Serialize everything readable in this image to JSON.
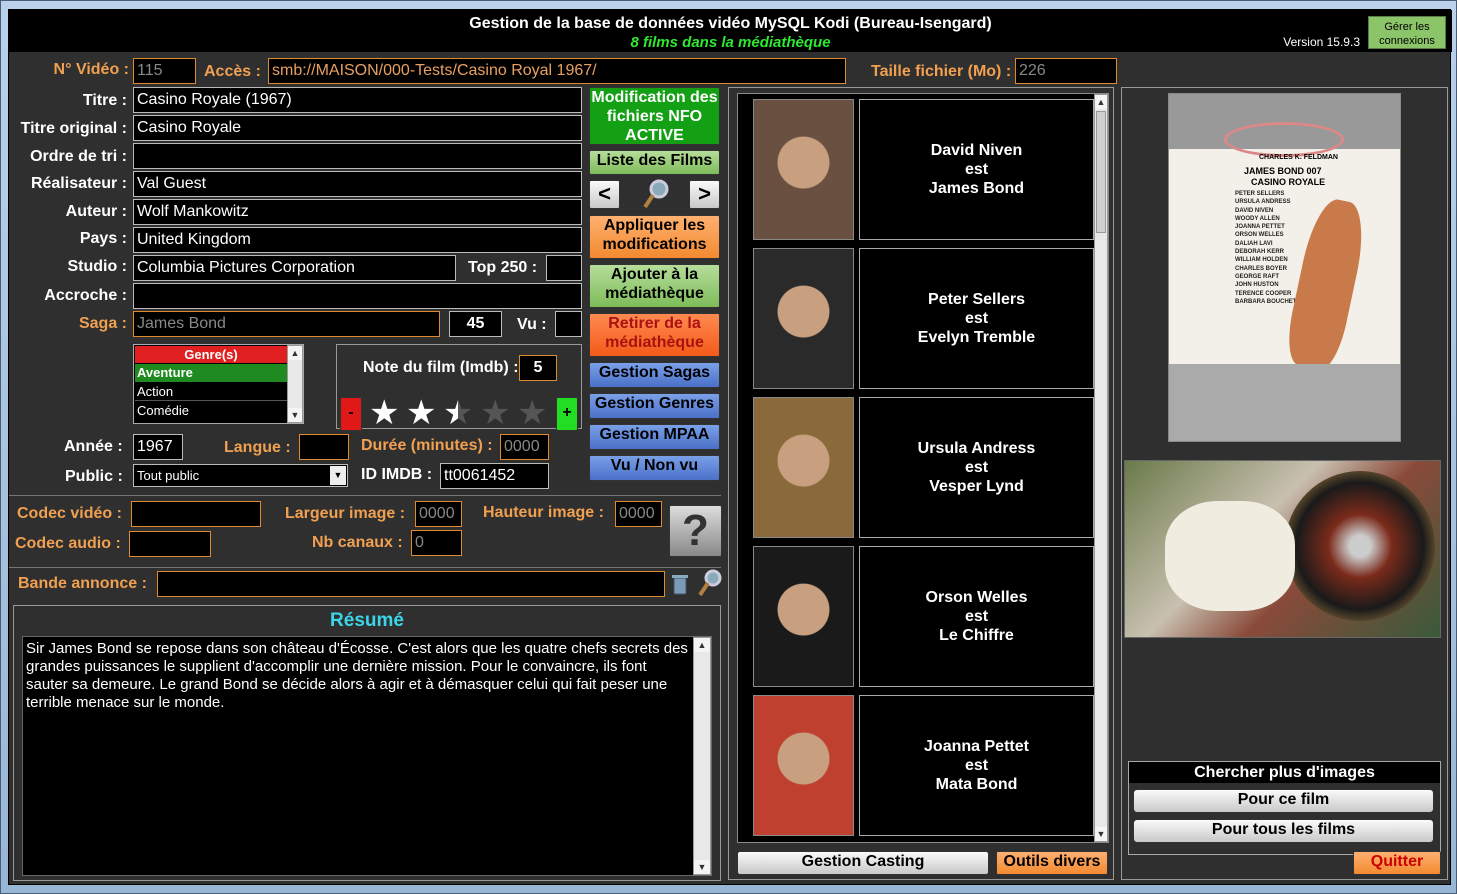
{
  "header": {
    "title": "Gestion de la base de données vidéo MySQL Kodi (Bureau-Isengard)",
    "subtitle": "8 films dans la médiathèque",
    "version": "Version 15.9.3",
    "connections_btn": "Gérer les connexions"
  },
  "fields": {
    "video_no_label": "N° Vidéo :",
    "video_no": "115",
    "access_label": "Accès :",
    "access": "smb://MAISON/000-Tests/Casino Royal 1967/",
    "size_label": "Taille fichier (Mo) :",
    "size": "226",
    "title_label": "Titre :",
    "title": "Casino Royale (1967)",
    "orig_title_label": "Titre original :",
    "orig_title": "Casino Royale",
    "sort_label": "Ordre de tri :",
    "sort": "",
    "director_label": "Réalisateur :",
    "director": "Val Guest",
    "author_label": "Auteur :",
    "author": "Wolf Mankowitz",
    "country_label": "Pays :",
    "country": "United Kingdom",
    "studio_label": "Studio :",
    "studio": "Columbia Pictures Corporation",
    "top250_label": "Top 250 :",
    "top250": "",
    "tagline_label": "Accroche :",
    "tagline": "",
    "saga_label": "Saga :",
    "saga": "James Bond",
    "saga_count": "45",
    "seen_label": "Vu :",
    "seen": "",
    "year_label": "Année :",
    "year": "1967",
    "lang_label": "Langue :",
    "lang": "",
    "duration_label": "Durée (minutes) :",
    "duration": "0000",
    "public_label": "Public :",
    "public": "Tout public",
    "imdb_label": "ID IMDB :",
    "imdb": "tt0061452",
    "vcodec_label": "Codec vidéo :",
    "vcodec": "",
    "acodec_label": "Codec audio :",
    "acodec": "",
    "width_label": "Largeur image :",
    "width": "0000",
    "height_label": "Hauteur image :",
    "height": "0000",
    "channels_label": "Nb canaux :",
    "channels": "0",
    "trailer_label": "Bande annonce :",
    "trailer": ""
  },
  "genres": {
    "header": "Genre(s)",
    "items": [
      "Aventure",
      "Action",
      "Comédie"
    ]
  },
  "rating": {
    "label": "Note du film (Imdb) :",
    "value": "5",
    "minus": "-",
    "plus": "+",
    "stars": 2.5,
    "max": 5
  },
  "buttons": {
    "nfo": "Modification des fichiers NFO ACTIVE",
    "films_list": "Liste des Films",
    "prev": "<",
    "next": ">",
    "apply": "Appliquer les modifications",
    "add": "Ajouter à la médiathèque",
    "remove": "Retirer de la médiathèque",
    "sagas": "Gestion Sagas",
    "genres": "Gestion Genres",
    "mpaa": "Gestion MPAA",
    "seen": "Vu / Non vu",
    "help": "?",
    "casting": "Gestion Casting",
    "tools": "Outils divers",
    "quit": "Quitter",
    "search_header": "Chercher plus d'images",
    "search_this": "Pour ce film",
    "search_all": "Pour tous les films"
  },
  "summary": {
    "title": "Résumé",
    "text": "Sir James Bond se repose dans son château d'Écosse. C'est alors que les quatre chefs secrets des grandes puissances le supplient d'accomplir une dernière mission. Pour le convaincre, ils font sauter sa demeure. Le grand Bond se décide alors à agir et à démasquer celui qui fait peser une terrible menace sur le monde."
  },
  "cast": [
    {
      "actor": "David Niven",
      "est": "est",
      "role": "James Bond"
    },
    {
      "actor": "Peter Sellers",
      "est": "est",
      "role": "Evelyn Tremble"
    },
    {
      "actor": "Ursula Andress",
      "est": "est",
      "role": "Vesper Lynd"
    },
    {
      "actor": "Orson Welles",
      "est": "est",
      "role": "Le Chiffre"
    },
    {
      "actor": "Joanna Pettet",
      "est": "est",
      "role": "Mata Bond"
    }
  ],
  "poster": {
    "producer": "CHARLES K. FELDMAN",
    "line1": "JAMES BOND 007",
    "line2": "CASINO ROYALE",
    "names": [
      "PETER SELLERS",
      "URSULA ANDRESS",
      "DAVID NIVEN",
      "WOODY ALLEN",
      "JOANNA PETTET",
      "ORSON WELLES",
      "DALIAH LAVI",
      "DEBORAH KERR",
      "WILLIAM HOLDEN",
      "CHARLES BOYER",
      "GEORGE RAFT",
      "JOHN HUSTON",
      "TERENCE COOPER",
      "BARBARA BOUCHET"
    ]
  }
}
